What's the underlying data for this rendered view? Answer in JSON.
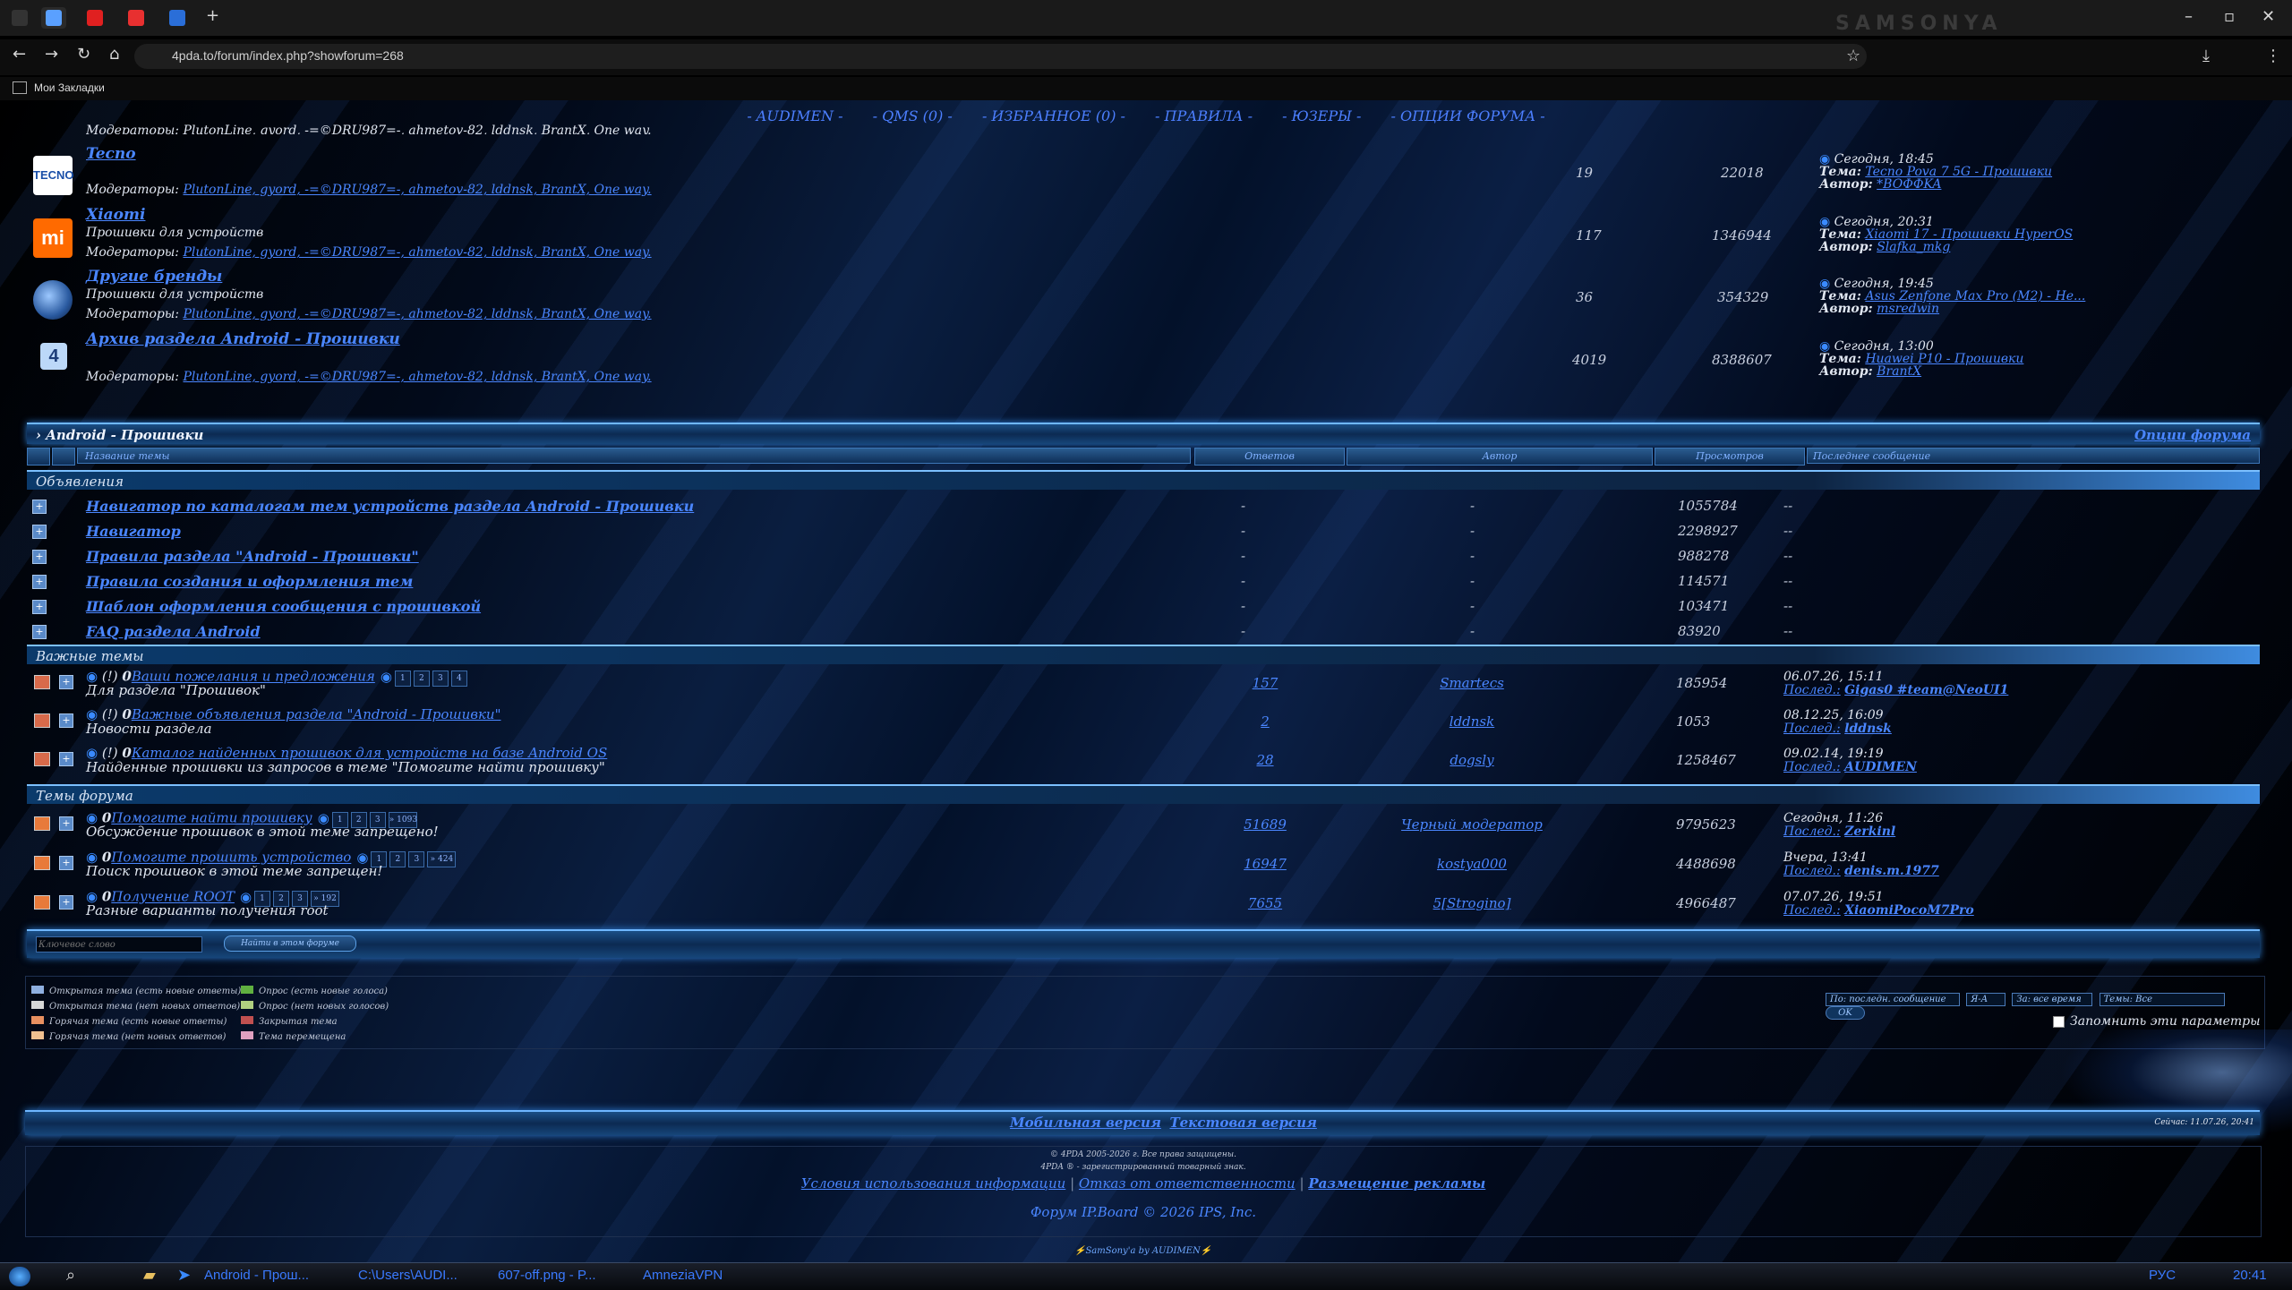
{
  "browser": {
    "url": "4pda.to/forum/index.php?showforum=268",
    "bookmarks_label": "Мои Закладки",
    "tab_new": "+",
    "tray_text": "SAMSONYA"
  },
  "topnav": [
    "- AUDIMEN -",
    "- QMS (0) -",
    "- ИЗБРАННОЕ (0) -",
    "- ПРАВИЛА -",
    "- ЮЗЕРЫ -",
    "- ОПЦИИ ФОРУМА -"
  ],
  "top_row_partial": "Модераторы: PlutonLine, gyord, -=©DRU987=-, ahmetov-82, lddnsk, BrantX, One way.",
  "subforums": [
    {
      "name": "Tecno",
      "desc": "",
      "mods_label": "Модераторы:",
      "mods": "PlutonLine, gyord, -=©DRU987=-, ahmetov-82, lddnsk, BrantX, One way.",
      "topics": "19",
      "posts": "22018",
      "date": "Сегодня, 18:45",
      "theme_label": "Тема:",
      "theme": "Tecno Pova 7 5G - Прошивки",
      "author_label": "Автор:",
      "author": "*BOФФKA",
      "icon_text": "TECNO"
    },
    {
      "name": "Xiaomi",
      "desc": "Прошивки для устройств",
      "mods_label": "Модераторы:",
      "mods": "PlutonLine, gyord, -=©DRU987=-, ahmetov-82, lddnsk, BrantX, One way.",
      "topics": "117",
      "posts": "1346944",
      "date": "Сегодня, 20:31",
      "theme_label": "Тема:",
      "theme": "Xiaomi 17 - Прошивки HyperOS",
      "author_label": "Автор:",
      "author": "Slafka_mkg",
      "icon_text": "mi"
    },
    {
      "name": "Другие бренды",
      "desc": "Прошивки для устройств",
      "mods_label": "Модераторы:",
      "mods": "PlutonLine, gyord, -=©DRU987=-, ahmetov-82, lddnsk, BrantX, One way.",
      "topics": "36",
      "posts": "354329",
      "date": "Сегодня, 19:45",
      "theme_label": "Тема:",
      "theme": "Asus Zenfone Max Pro (M2) - Не...",
      "author_label": "Автор:",
      "author": "msredwin",
      "icon_text": ""
    },
    {
      "name": "Архив раздела Android - Прошивки",
      "desc": "",
      "mods_label": "Модераторы:",
      "mods": "PlutonLine, gyord, -=©DRU987=-, ahmetov-82, lddnsk, BrantX, One way.",
      "topics": "4019",
      "posts": "8388607",
      "date": "Сегодня, 13:00",
      "theme_label": "Тема:",
      "theme": "Huawei P10 - Прошивки",
      "author_label": "Автор:",
      "author": "BrantX",
      "icon_text": "4"
    }
  ],
  "topics_header": {
    "title": "Android - Прошивки",
    "options": "Опции форума",
    "cols": [
      "Название темы",
      "Ответов",
      "Автор",
      "Просмотров",
      "Последнее сообщение"
    ]
  },
  "announcements_label": "Объявления",
  "announcements": [
    {
      "title": "Навигатор по каталогам тем устройств раздела Android - Прошивки",
      "replies": "-",
      "author": "-",
      "views": "1055784",
      "last": "--"
    },
    {
      "title": "Навигатор",
      "replies": "-",
      "author": "-",
      "views": "2298927",
      "last": "--"
    },
    {
      "title": "Правила раздела \"Android - Прошивки\"",
      "replies": "-",
      "author": "-",
      "views": "988278",
      "last": "--"
    },
    {
      "title": "Правила создания и оформления тем",
      "replies": "-",
      "author": "-",
      "views": "114571",
      "last": "--"
    },
    {
      "title": "Шаблон оформления сообщения с прошивкой",
      "replies": "-",
      "author": "-",
      "views": "103471",
      "last": "--"
    },
    {
      "title": "FAQ раздела Android",
      "replies": "-",
      "author": "-",
      "views": "83920",
      "last": "--"
    }
  ],
  "important_label": "Важные темы",
  "important": [
    {
      "prefix": "(!)",
      "title": "Ваши пожелания и предложения",
      "desc": "Для раздела \"Прошивок\"",
      "pages": [
        "1",
        "2",
        "3",
        "4"
      ],
      "replies": "157",
      "author": "Smartecs",
      "views": "185954",
      "date": "06.07.26, 15:11",
      "last_label": "Послед.:",
      "last": "Gigas0 #team@NeoUI1"
    },
    {
      "prefix": "(!)",
      "title": "Важные объявления раздела \"Android - Прошивки\"",
      "desc": "Новости раздела",
      "pages": [],
      "replies": "2",
      "author": "lddnsk",
      "views": "1053",
      "date": "08.12.25, 16:09",
      "last_label": "Послед.:",
      "last": "lddnsk"
    },
    {
      "prefix": "(!)",
      "title": "Каталог найденных прошивок для устройств на базе Android OS",
      "desc": "Найденные прошивки из запросов в теме \"Помогите найти прошивку\"",
      "pages": [],
      "replies": "28",
      "author": "dogsly",
      "views": "1258467",
      "date": "09.02.14, 19:19",
      "last_label": "Послед.:",
      "last": "AUDIMEN"
    }
  ],
  "forum_topics_label": "Темы форума",
  "forum_topics": [
    {
      "title": "Помогите найти прошивку",
      "desc": "Обсуждение прошивок в этой теме запрещено!",
      "pages": [
        "1",
        "2",
        "3",
        "» 1093"
      ],
      "replies": "51689",
      "author": "Черный модератор",
      "views": "9795623",
      "date": "Сегодня, 11:26",
      "last_label": "Послед.:",
      "last": "Zerkinl"
    },
    {
      "title": "Помогите прошить устройство",
      "desc": "Поиск прошивок в этой теме запрещен!",
      "pages": [
        "1",
        "2",
        "3",
        "» 424"
      ],
      "replies": "16947",
      "author": "kostya000",
      "views": "4488698",
      "date": "Вчера, 13:41",
      "last_label": "Послед.:",
      "last": "denis.m.1977"
    },
    {
      "title": "Получение ROOT",
      "desc": "Разные варианты получения root",
      "pages": [
        "1",
        "2",
        "3",
        "» 192"
      ],
      "replies": "7655",
      "author": "5[Strogino]",
      "views": "4966487",
      "date": "07.07.26, 19:51",
      "last_label": "Послед.:",
      "last": "XiaomiPocoM7Pro"
    }
  ],
  "search": {
    "placeholder": "Ключевое слово",
    "button": "Найти в этом форуме"
  },
  "legend": [
    "Открытая тема (есть новые ответы)",
    "Открытая тема (нет новых ответов)",
    "Горячая тема (есть новые ответы)",
    "Горячая тема (нет новых ответов)",
    "Опрос (есть новые голоса)",
    "Опрос (нет новых голосов)",
    "Закрытая тема",
    "Тема перемещена"
  ],
  "sort": {
    "by": "По: последн. сообщение",
    "order": "Я-А",
    "period": "За: все время",
    "type": "Темы: Все",
    "go": "OK",
    "remember": "Запомнить эти параметры"
  },
  "footer": {
    "mobile": "Мобильная версия",
    "text": "Текстовая версия",
    "now": "Сейчас: 11.07.26, 20:41",
    "copyright": "© 4PDA 2005-2026 г. Все права защищены.",
    "trademark": "4PDA ® - зарегистрированный товарный знак.",
    "terms": "Условия использования информации",
    "disclaimer": "Отказ от ответственности",
    "ads": "Размещение рекламы",
    "board": "Форум IP.Board © 2026 IPS, Inc.",
    "skin": "SamSony'a by AUDIMEN"
  },
  "taskbar": {
    "items": [
      "Android - Прош...",
      "C:\\Users\\AUDI...",
      "607-off.png - P...",
      "AmneziaVPN"
    ],
    "lang": "РУС",
    "time": "20:41"
  },
  "colors": {
    "link": "#4a86ff",
    "bar": "#1b4f86",
    "accent": "#6fb7ff"
  }
}
